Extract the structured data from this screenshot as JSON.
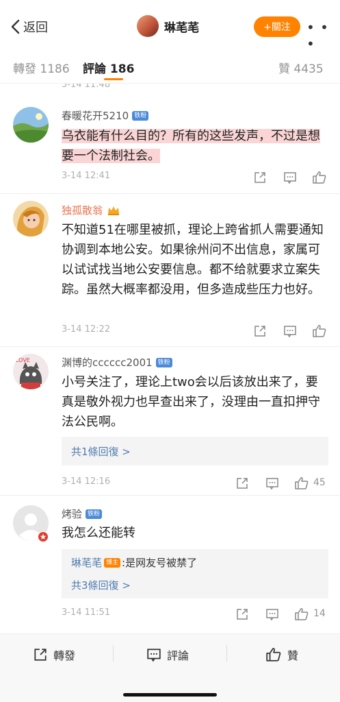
{
  "nav": {
    "back_label": "返回",
    "author_name": "琳芼芼",
    "follow_label": "+關注",
    "more_label": "• • •"
  },
  "tabs": {
    "repost": "轉發 1186",
    "comments": "評論 186",
    "likes": "贊 4435"
  },
  "partial_timestamp": "3-14 11:48",
  "comments": [
    {
      "user": "春暖花开5210",
      "badge": "铁粉",
      "text": "乌衣能有什么目的？所有的这些发声，不过是想要一个法制社会。",
      "time": "3-14 12:41",
      "likes": ""
    },
    {
      "user": "独孤散翁",
      "badge": "",
      "text": "不知道51在哪里被抓，理论上跨省抓人需要通知协调到本地公安。如果徐州问不出信息，家属可以试试找当地公安要信息。都不给就要求立案失踪。虽然大概率都没用，但多造成些压力也好。",
      "time": "3-14 12:22",
      "likes": ""
    },
    {
      "user": "渊博的cccccc2001",
      "badge": "铁粉",
      "text": "小号关注了，理论上two会以后该放出来了，要真是敬外视力也早查出来了，没理由一直扣押守法公民啊。",
      "reply_count": "共1條回復 >",
      "time": "3-14 12:16",
      "likes": "45"
    },
    {
      "user": "烤验",
      "badge": "铁粉",
      "text": "我怎么还能转",
      "reply_user": "琳芼芼",
      "reply_badge": "博主",
      "reply_text": ":是网友号被禁了",
      "reply_count": "共3條回復 >",
      "time": "3-14 11:51",
      "likes": "14"
    }
  ],
  "bottom": {
    "repost": "轉發",
    "comment": "評論",
    "like": "贊"
  },
  "colors": {
    "accent": "#ff8200",
    "highlight": "#fbd5d5",
    "link_blue": "#507daf",
    "orange_name": "#eb7350"
  }
}
